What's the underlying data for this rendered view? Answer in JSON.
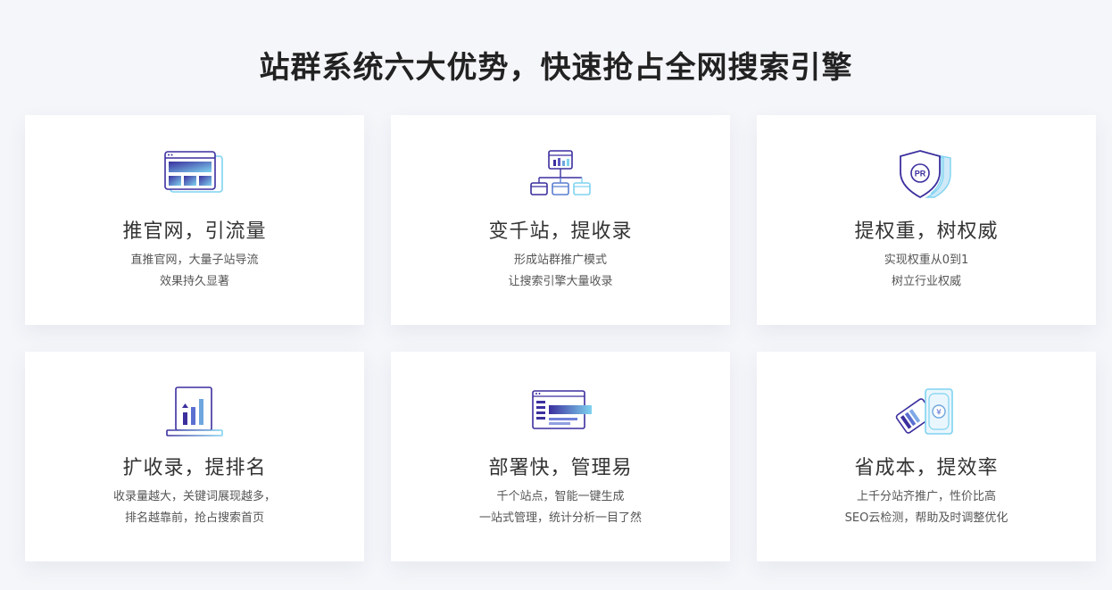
{
  "page": {
    "title": "站群系统六大优势，快速抢占全网搜索引擎"
  },
  "cards": [
    {
      "title": "推官网，引流量",
      "line1": "直推官网，大量子站导流",
      "line2": "效果持久显著",
      "icon": "browser-windows-icon"
    },
    {
      "title": "变千站，提收录",
      "line1": "形成站群推广模式",
      "line2": "让搜索引擎大量收录",
      "icon": "sitemap-icon"
    },
    {
      "title": "提权重，树权威",
      "line1": "实现权重从0到1",
      "line2": "树立行业权威",
      "icon": "pr-shield-icon"
    },
    {
      "title": "扩收录，提排名",
      "line1": "收录量越大，关键词展现越多，",
      "line2": "排名越靠前，抢占搜索首页",
      "icon": "bar-chart-icon"
    },
    {
      "title": "部署快，管理易",
      "line1": "千个站点，智能一键生成",
      "line2": "一站式管理，统计分析一目了然",
      "icon": "dashboard-window-icon"
    },
    {
      "title": "省成本，提效率",
      "line1": "上千分站齐推广，性价比高",
      "line2": "SEO云检测，帮助及时调整优化",
      "icon": "money-cards-icon"
    }
  ],
  "colors": {
    "icon_dark": "#3b2f9e",
    "icon_light": "#7fd3f0"
  }
}
